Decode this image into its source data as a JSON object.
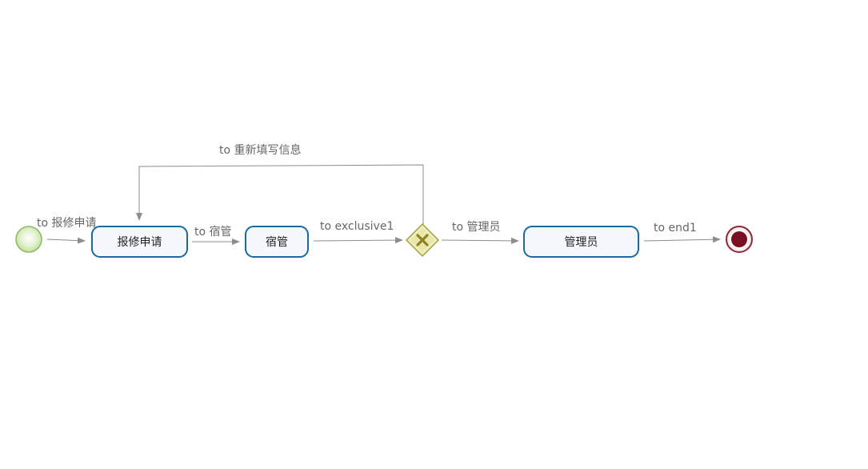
{
  "diagram": {
    "nodes": {
      "start": {
        "type": "start-event"
      },
      "task_apply": {
        "type": "user-task",
        "label": "报修申请"
      },
      "task_dorm": {
        "type": "user-task",
        "label": "宿管"
      },
      "gateway": {
        "type": "exclusive-gateway",
        "icon": "x-icon"
      },
      "task_admin": {
        "type": "user-task",
        "label": "管理员"
      },
      "end": {
        "type": "end-event"
      }
    },
    "edges": {
      "to_apply": {
        "label": "to 报修申请"
      },
      "to_dorm": {
        "label": "to 宿管"
      },
      "to_exclusive": {
        "label": "to exclusive1"
      },
      "to_refill": {
        "label": "to 重新填写信息"
      },
      "to_admin": {
        "label": "to 管理员"
      },
      "to_end": {
        "label": "to end1"
      }
    },
    "colors": {
      "task_border": "#1b6a9e",
      "task_fill": "#f4f7fc",
      "edge": "#8c8c8c",
      "start_fill": "#d6ecc0",
      "start_stroke": "#8cb865",
      "gateway_fill": "#e8e6a8",
      "gateway_stroke": "#a6a13a",
      "end_fill": "#7a1022",
      "end_stroke": "#8a2a3a"
    }
  }
}
